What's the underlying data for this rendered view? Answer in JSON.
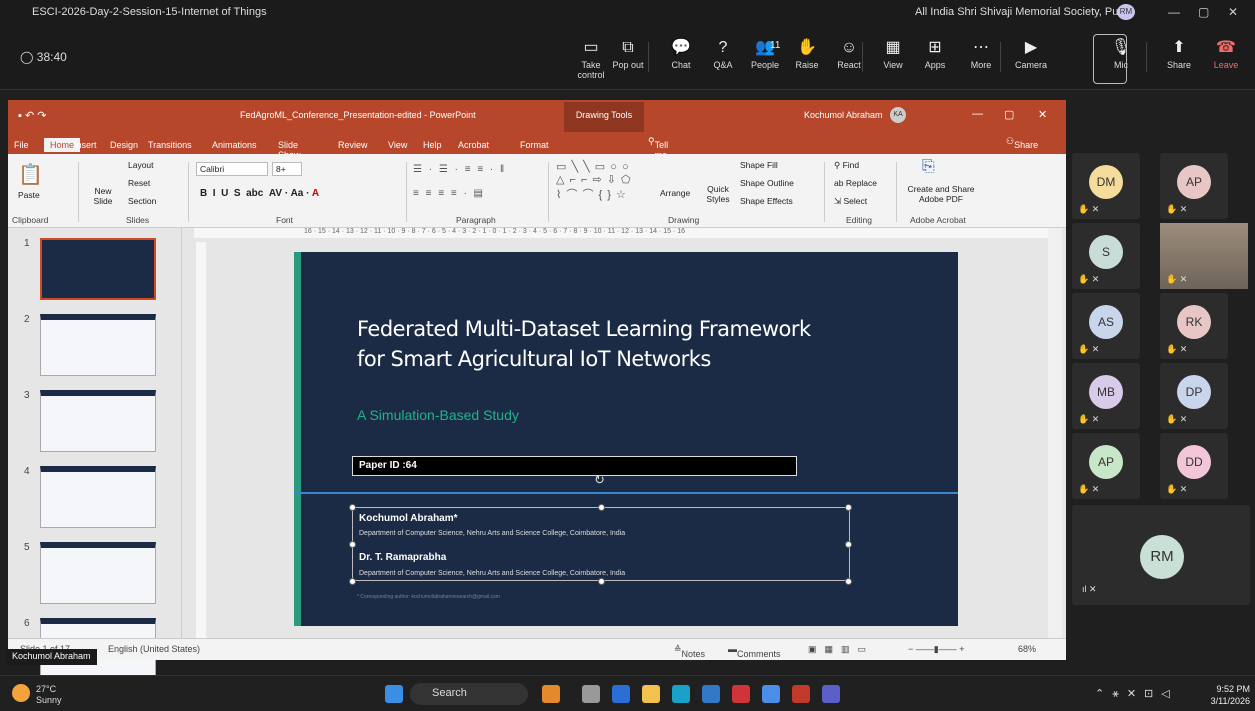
{
  "titlebar": {
    "title": "ESCI-2026-Day-2-Session-15-Internet of Things",
    "org": "All India Shri Shivaji Memorial Society, Pune",
    "avatar": "RM"
  },
  "meeting": {
    "timer": "38:40",
    "buttons": [
      {
        "label": "Take control",
        "icon": "▭"
      },
      {
        "label": "Pop out",
        "icon": "⧉"
      },
      {
        "label": "Chat",
        "icon": "💬"
      },
      {
        "label": "Q&A",
        "icon": "?"
      },
      {
        "label": "People",
        "icon": "👥"
      },
      {
        "label": "Raise",
        "icon": "✋"
      },
      {
        "label": "React",
        "icon": "☺"
      },
      {
        "label": "View",
        "icon": "▦"
      },
      {
        "label": "Apps",
        "icon": "⊞"
      },
      {
        "label": "More",
        "icon": "⋯"
      },
      {
        "label": "Camera",
        "icon": "▶"
      },
      {
        "label": "Mic",
        "icon": "🎙"
      },
      {
        "label": "Share",
        "icon": "⬆"
      },
      {
        "label": "Leave",
        "icon": "☎"
      }
    ],
    "people_count": "11"
  },
  "ppt": {
    "filename": "FedAgroML_Conference_Presentation-edited - PowerPoint",
    "context": "Drawing Tools",
    "user": "Kochumol Abraham",
    "user_initials": "KA",
    "tabs": [
      "File",
      "Home",
      "Insert",
      "Design",
      "Transitions",
      "Animations",
      "Slide Show",
      "Review",
      "View",
      "Help",
      "Acrobat",
      "Format"
    ],
    "tell": "Tell me what you want to do",
    "share": "Share",
    "ribbon": {
      "paste": "Paste",
      "new_slide": "New Slide",
      "layout": "Layout",
      "reset": "Reset",
      "section": "Section",
      "font": "Calibri",
      "size": "8+",
      "arrange": "Arrange",
      "quick_styles": "Quick Styles",
      "shape_fill": "Shape Fill",
      "shape_outline": "Shape Outline",
      "shape_effects": "Shape Effects",
      "find": "Find",
      "replace": "Replace",
      "select": "Select",
      "create_pdf": "Create and Share Adobe PDF",
      "groups": [
        "Clipboard",
        "Slides",
        "Font",
        "Paragraph",
        "Drawing",
        "Editing",
        "Adobe Acrobat"
      ]
    },
    "ruler": "16 · 15 · 14 · 13 · 12 · 11 · 10 · 9 · 8 · 7 · 6 · 5 · 4 · 3 · 2 · 1 · 0 · 1 · 2 · 3 · 4 · 5 · 6 · 7 · 8 · 9 · 10 · 11 · 12 · 13 · 14 · 15 · 16",
    "thumb_numbers": [
      "1",
      "2",
      "3",
      "4",
      "5",
      "6"
    ],
    "slide": {
      "title1": "Federated Multi-Dataset Learning Framework",
      "title2": "for Smart Agricultural IoT Networks",
      "subtitle": "A Simulation-Based Study",
      "paper": "Paper ID :64",
      "author1": "Kochumol Abraham*",
      "dept1": "Department of Computer Science, Nehru Arts and Science College, Coimbatore, India",
      "author2": "Dr. T. Ramaprabha",
      "dept2": "Department of Computer Science, Nehru Arts and Science College, Coimbatore, India",
      "footnote": "* Corresponding author: kochumolabrahamresearch@gmail.com"
    },
    "status": {
      "slide": "Slide 1 of 17",
      "lang": "English (United States)",
      "notes": "Notes",
      "comments": "Comments",
      "zoom": "68%"
    }
  },
  "presenter_name": "Kochumol Abraham",
  "participants": [
    {
      "initials": "DM",
      "color": "#f5dc9b"
    },
    {
      "initials": "AP",
      "color": "#e9c6c6"
    },
    {
      "initials": "S",
      "color": "#c8ddd8"
    },
    {
      "initials": "",
      "color": "#8a7a6a"
    },
    {
      "initials": "AS",
      "color": "#c9d5ea"
    },
    {
      "initials": "RK",
      "color": "#e9c6c6"
    },
    {
      "initials": "MB",
      "color": "#d7cbe9"
    },
    {
      "initials": "DP",
      "color": "#c9d5ea"
    },
    {
      "initials": "AP",
      "color": "#c8e6c8"
    },
    {
      "initials": "DD",
      "color": "#f2c6d8"
    }
  ],
  "large_participant": {
    "initials": "RM",
    "color": "#c8e0d6"
  },
  "taskbar": {
    "temp": "27°C",
    "weather": "Sunny",
    "search": "Search",
    "time": "9:52 PM",
    "date": "3/11/2026"
  }
}
